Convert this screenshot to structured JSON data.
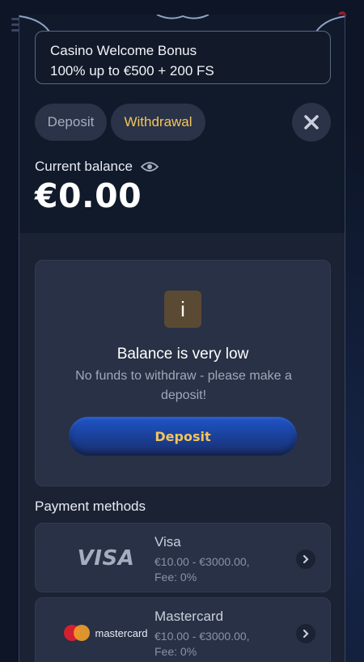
{
  "bonus": {
    "line1": "Casino Welcome Bonus",
    "line2": "100% up to €500 + 200 FS"
  },
  "tabs": {
    "deposit": "Deposit",
    "withdrawal": "Withdrawal",
    "active": "withdrawal"
  },
  "balance": {
    "label": "Current balance",
    "amount": "€0.00"
  },
  "notice": {
    "badge": "i",
    "title": "Balance is very low",
    "description": "No funds to withdraw - please make a deposit!",
    "button": "Deposit"
  },
  "payment_methods": {
    "label": "Payment methods",
    "items": [
      {
        "logo": "VISA",
        "name": "Visa",
        "range": "€10.00 - €3000.00,",
        "fee": "Fee: 0%"
      },
      {
        "logo": "mastercard",
        "name": "Mastercard",
        "range": "€10.00 - €3000.00,",
        "fee": "Fee: 0%"
      }
    ]
  },
  "colors": {
    "accent_gold": "#f4c55c",
    "primary_blue": "#1f55c8",
    "surface": "#283145"
  },
  "icons": [
    "close-icon",
    "eye-icon",
    "info-icon",
    "chevron-right-icon",
    "menu-icon"
  ]
}
